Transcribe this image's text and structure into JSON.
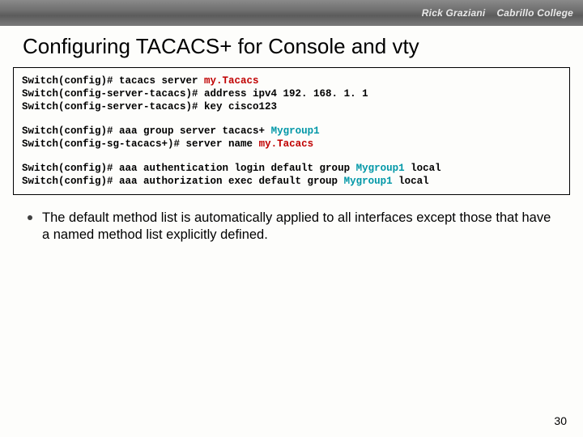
{
  "header": {
    "author_name": "Rick Graziani",
    "college": "Cabrillo College"
  },
  "title": "Configuring TACACS+ for Console and vty",
  "code": {
    "block1": {
      "l1_prefix": "Switch(config)# tacacs server ",
      "l1_kw": "my.Tacacs",
      "l2": "Switch(config-server-tacacs)# address ipv4 192. 168. 1. 1",
      "l3": "Switch(config-server-tacacs)# key cisco123"
    },
    "block2": {
      "l1_prefix": "Switch(config)# aaa group server tacacs+ ",
      "l1_kw": "Mygroup1",
      "l2_prefix": "Switch(config-sg-tacacs+)# server name ",
      "l2_kw": "my.Tacacs"
    },
    "block3": {
      "l1_prefix": "Switch(config)# aaa authentication login default group ",
      "l1_kw": "Mygroup1",
      "l1_suffix": " local",
      "l2_prefix": "Switch(config)# aaa authorization exec default group ",
      "l2_kw": "Mygroup1",
      "l2_suffix": " local"
    }
  },
  "bullet": "The default method list is automatically applied to all interfaces except those that have a named method list explicitly defined.",
  "page_number": "30"
}
